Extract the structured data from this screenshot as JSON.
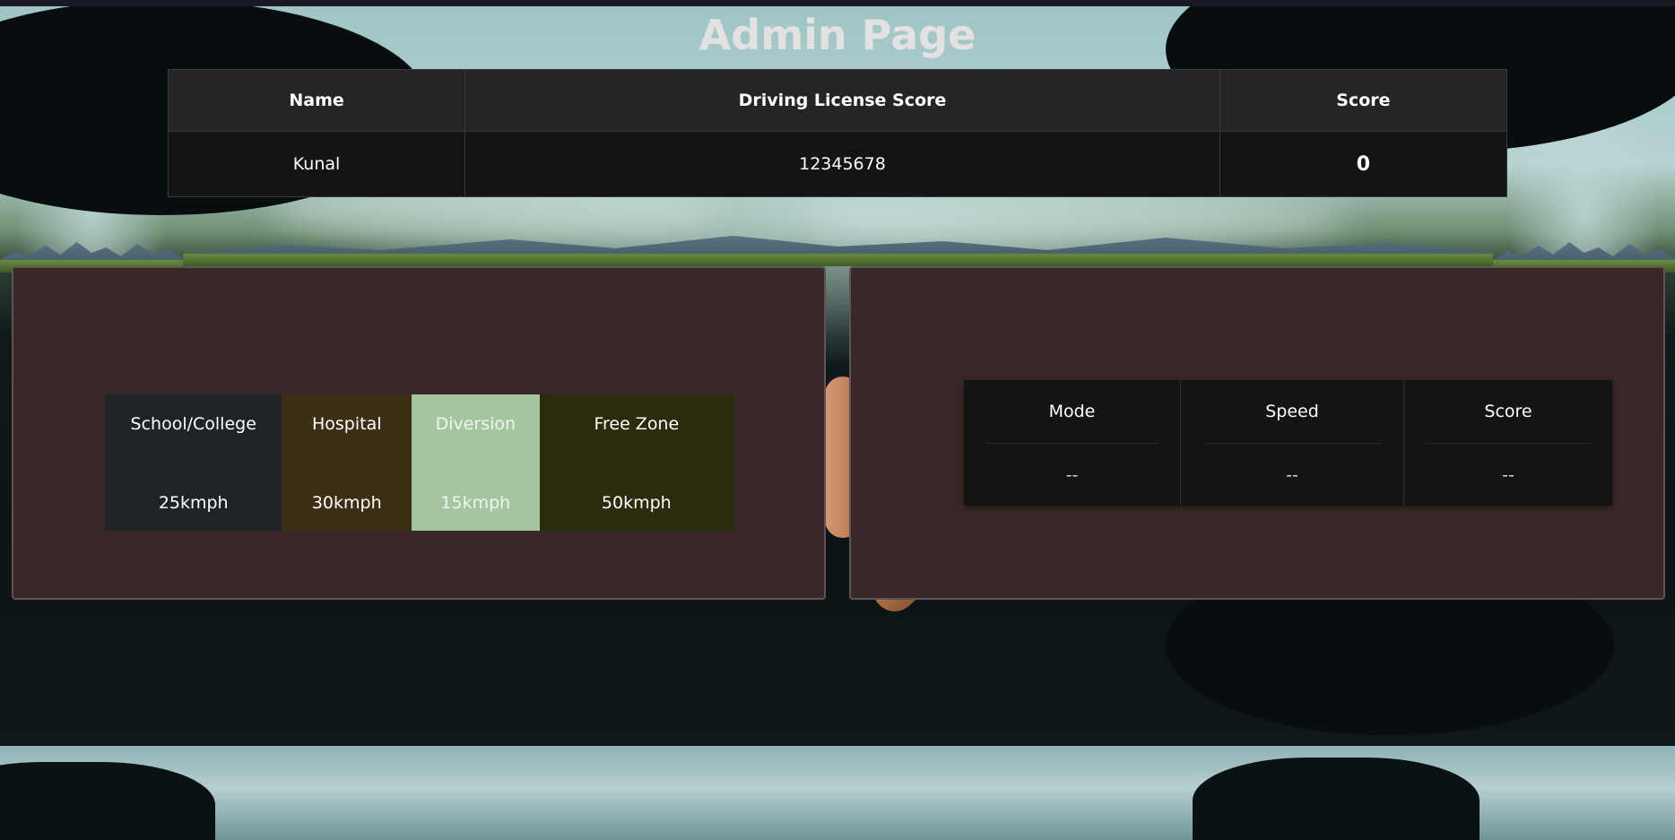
{
  "page": {
    "title": "Admin Page"
  },
  "user_table": {
    "headers": {
      "name": "Name",
      "license": "Driving License Score",
      "score": "Score"
    },
    "rows": [
      {
        "name": "Kunal",
        "license": "12345678",
        "score": "0"
      }
    ]
  },
  "zones": [
    {
      "name": "School/College",
      "speed": "25kmph",
      "color": "#1f2328"
    },
    {
      "name": "Hospital",
      "speed": "30kmph",
      "color": "#3d2f14"
    },
    {
      "name": "Diversion",
      "speed": "15kmph",
      "color": "#a3c6a1"
    },
    {
      "name": "Free Zone",
      "speed": "50kmph",
      "color": "#2a2c0c"
    }
  ],
  "readings": {
    "mode": {
      "label": "Mode",
      "value": "--"
    },
    "speed": {
      "label": "Speed",
      "value": "--"
    },
    "score": {
      "label": "Score",
      "value": "--"
    }
  },
  "colors": {
    "panel_bg": "#3a2828",
    "table_header_bg": "#252525",
    "table_row_bg": "#141414"
  }
}
